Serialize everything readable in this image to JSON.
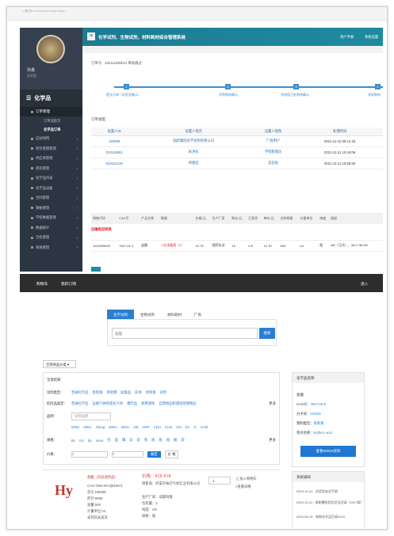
{
  "top_strip": "• 第1页 ••• •••••• ••••••• •••••• ••••••••",
  "admin": {
    "header": {
      "title": "化学试剂、生物试剂、材料耗材综合管理系统",
      "right1": "用户手册",
      "right2": "系统设置"
    },
    "sidebar": {
      "username": "孙勇",
      "role": "实验室",
      "category": "化学品",
      "group": "订单管理",
      "subs": [
        {
          "label": "订单追踪页"
        },
        {
          "label": "化学品订单"
        }
      ],
      "items": [
        {
          "label": "自动领用"
        },
        {
          "label": "库存管理管理"
        },
        {
          "label": "供应商管理"
        },
        {
          "label": "库房管理"
        },
        {
          "label": "化学品目录"
        },
        {
          "label": "化学品设备"
        },
        {
          "label": "合同管理"
        },
        {
          "label": "销帐管理"
        },
        {
          "label": "学校数据管理"
        },
        {
          "label": "数据统计"
        },
        {
          "label": "全校管理"
        },
        {
          "label": "系统管理"
        }
      ]
    },
    "order_line": "订单号：202111090014   审核通过",
    "steps": [
      {
        "n": "1",
        "label": "提交订单（实验室确认）"
      },
      {
        "n": "2",
        "label": "学院审核确认"
      },
      {
        "n": "3",
        "label": "学校保卫处审核确认"
      },
      {
        "n": "4",
        "label": "学校审核"
      }
    ],
    "progress_title": "订单进度",
    "table1": {
      "headers": [
        "设置人ID",
        "设置人姓名",
        "设置人角色",
        "处理时间"
      ],
      "rows": [
        [
          "J20099",
          "国药集团化学试剂有限公司",
          "厂商用户",
          "2021-11-10 09:14:16"
        ],
        [
          "010115051",
          "朱洪庆",
          "学院管理员",
          "2021-11-11 10:44:06"
        ],
        [
          "010114126",
          "师富宏",
          "实验处",
          "2021-11-11 15:58:20"
        ]
      ]
    },
    "table2": {
      "headers": [
        "销售代码",
        "CAS号",
        "产品名称",
        "数量",
        "价格/元",
        "生产厂家",
        "购价/元",
        "已到货",
        "单价/元",
        "试剂规格",
        "计量单位",
        "纯度",
        "描述"
      ],
      "row": [
        "1129939003",
        "7647-01-0",
        "盐酸",
        "1 必须备案（1）",
        "12.75",
        "国药化试",
        "16",
        "0.8",
        "12.75",
        "500",
        "ml",
        "瓶",
        "AR（汪式），36.0~38.0%"
      ]
    },
    "count_note": "运输类运种类"
  },
  "shop": {
    "nav": {
      "cart": "购物车",
      "orders": "我的订购",
      "logout": "退入"
    },
    "tabs": [
      {
        "label": "化学试剂",
        "active": true
      },
      {
        "label": "生物试剂",
        "active": false
      },
      {
        "label": "材料耗材",
        "active": false
      },
      {
        "label": "厂商",
        "active": false
      }
    ],
    "search": {
      "value": "盐酸",
      "button": "搜索"
    },
    "all_categories": "全部商品分类",
    "filters": {
      "title": "全部结果：",
      "type_label": "试剂类型：",
      "types": [
        "普通化学品",
        "易制毒",
        "易制爆",
        "剧毒品",
        "前体",
        "易制毒",
        "试剂"
      ],
      "hazard_label": "危险品类型：",
      "hazards": [
        "普通化学品",
        "压缩气体和液化气体",
        "爆炸品",
        "易燃液体",
        "自燃物品和遇湿易燃物品"
      ],
      "brand_label": "品牌：",
      "brand_placeholder": "试剂品牌",
      "more": "更多",
      "grades": [
        "000U",
        "000U",
        "zheng",
        "500U",
        "500U",
        "AM",
        "AMP",
        "CDU",
        "CLM",
        "CM",
        "EA",
        "G",
        "G-50"
      ],
      "spec_label": "规格：",
      "specs": [
        "BL",
        "EA",
        "bp",
        "none",
        "包",
        "盒",
        "罐",
        "支",
        "袋",
        "卷",
        "瓶",
        "瓶",
        "瓶",
        "桶",
        "袋"
      ],
      "price_label": "价格：",
      "price_ok": "确定",
      "order_by": "价 格"
    },
    "side": {
      "title": "化学品名称",
      "name": "盐酸",
      "cas_k": "CAS号：",
      "cas": "7647-93-9",
      "formula_k": "分子式：",
      "formula": "H2O46",
      "type_k": "管制类型：",
      "type": "易制毒",
      "en_k": "英文名称：",
      "en": "Sulfuric acid",
      "msds": "查看MSDS资料"
    },
    "notice": {
      "title": "系统通知",
      "items": [
        "2019-10-22 · 实验室安全手册",
        "2019-10-11 · 易制爆危险化学品目录（2017版）",
        "2019-05-15 · 易制化学品目录2015"
      ]
    },
    "product": {
      "name": "盐酸（实验试剂品）",
      "cas": "CAS:7664-93-9(81007)",
      "code": "货号:HM099",
      "stock": "库存:9999",
      "vol": "容量:500",
      "unit": "计量单位:ml",
      "ship": "未到货未发货",
      "price": "价格：¥18 ¥18",
      "seller": "销售商：西安市纳巧气体实业有限公司",
      "maker": "生产厂家：成都科隆",
      "bundle": "包装量：1",
      "purity": "纯度：AR",
      "pack": "规格：瓶",
      "qty": "1",
      "add": "加入购物车",
      "detail": "查看详情"
    }
  }
}
